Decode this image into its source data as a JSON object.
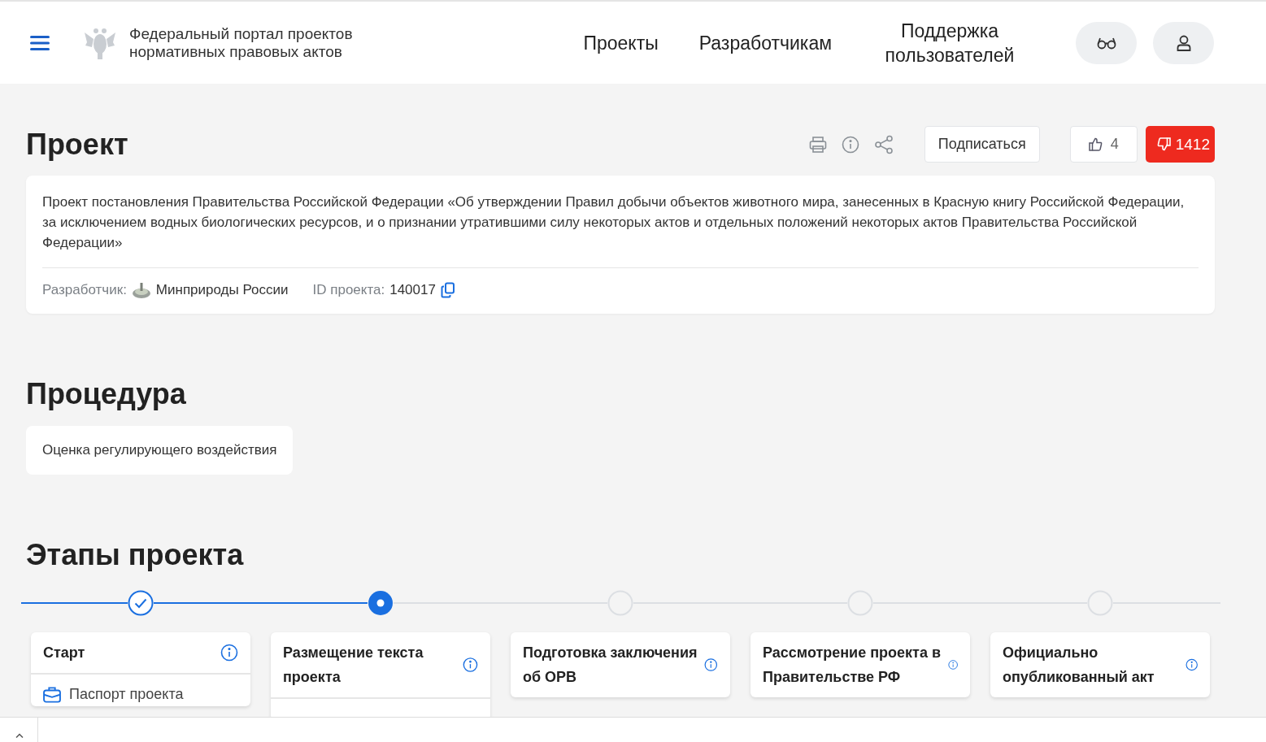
{
  "header": {
    "portal_title_line1": "Федеральный портал проектов",
    "portal_title_line2": "нормативных правовых актов",
    "nav": [
      {
        "label": "Проекты"
      },
      {
        "label": "Разработчикам"
      },
      {
        "label": "Поддержка пользователей"
      }
    ]
  },
  "project": {
    "heading": "Проект",
    "subscribe": "Подписаться",
    "likes": "4",
    "dislikes": "1412",
    "description": "Проект постановления Правительства Российской Федерации «Об утверждении Правил добычи объектов животного мира, занесенных в Красную книгу Российской Федерации, за исключением водных биологических ресурсов, и о признании утратившими силу некоторых актов и отдельных положений некоторых актов Правительства Российской Федерации»",
    "developer_label": "Разработчик:",
    "developer": "Минприроды России",
    "id_label": "ID проекта:",
    "id": "140017"
  },
  "procedure": {
    "heading": "Процедура",
    "value": "Оценка регулирующего воздействия"
  },
  "stages": {
    "heading": "Этапы проекта",
    "items": [
      {
        "title": "Старт",
        "completed": true,
        "selected": false,
        "expanded": true,
        "items": [
          {
            "label": "Паспорт проекта"
          }
        ]
      },
      {
        "title": "Размещение текста проекта",
        "completed": false,
        "selected": true,
        "expanded": true
      },
      {
        "title": "Подготовка заключения об ОРВ",
        "completed": false,
        "selected": false,
        "expanded": false
      },
      {
        "title": "Рассмотрение проекта в Правительстве РФ",
        "completed": false,
        "selected": false,
        "expanded": false
      },
      {
        "title": "Официально опубликованный акт",
        "completed": false,
        "selected": false,
        "expanded": false
      }
    ]
  }
}
